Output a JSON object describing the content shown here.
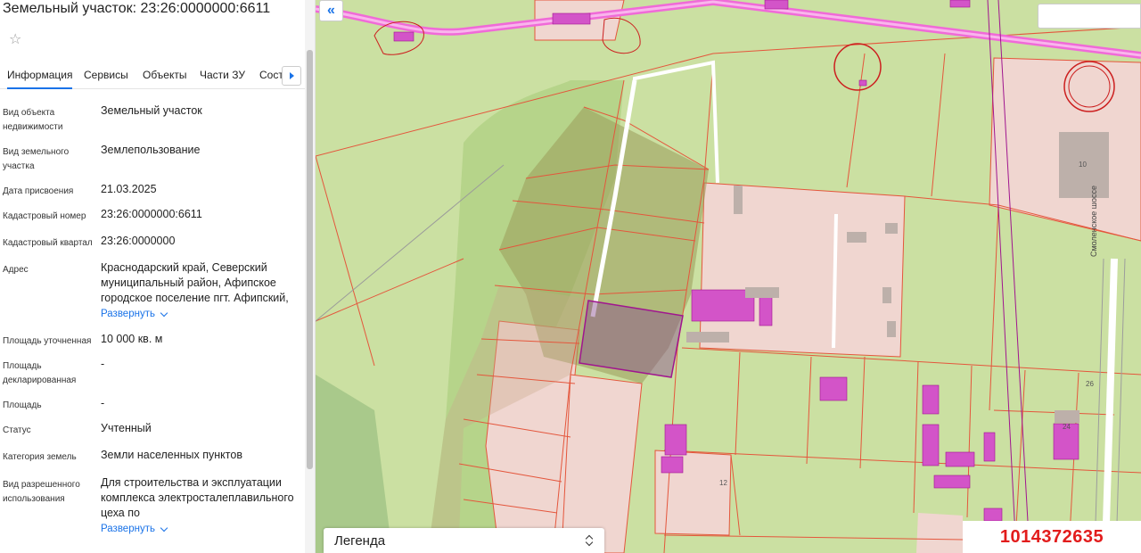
{
  "panel": {
    "title": "Земельный участок: 23:26:0000000:6611",
    "tabs": [
      {
        "label": "Информация"
      },
      {
        "label": "Сервисы"
      },
      {
        "label": "Объекты"
      },
      {
        "label": "Части ЗУ"
      },
      {
        "label": "Состав"
      }
    ],
    "more_label": "Развернуть",
    "rows": [
      {
        "label": "Вид объекта недвижимости",
        "value": "Земельный участок"
      },
      {
        "label": "Вид земельного участка",
        "value": "Землепользование"
      },
      {
        "label": "Дата присвоения",
        "value": "21.03.2025"
      },
      {
        "label": "Кадастровый номер",
        "value": "23:26:0000000:6611"
      },
      {
        "label": "Кадастровый квартал",
        "value": "23:26:0000000"
      },
      {
        "label": "Адрес",
        "value": "Краснодарский край, Северский муниципальный район, Афипское городское поселение пгт. Афипский,"
      },
      {
        "label": "Площадь уточненная",
        "value": "10 000 кв. м"
      },
      {
        "label": "Площадь декларированная",
        "value": "-"
      },
      {
        "label": "Площадь",
        "value": "-"
      },
      {
        "label": "Статус",
        "value": "Учтенный"
      },
      {
        "label": "Категория земель",
        "value": "Земли населенных пунктов"
      },
      {
        "label": "Вид разрешенного использования",
        "value": "Для строительства и эксплуатации комплекса электросталеплавильного цеха по"
      }
    ]
  },
  "map": {
    "collapse_glyph": "«",
    "legend_label": "Легенда",
    "road_label": "Смоленское шоссе",
    "listing_id": "1014372635",
    "parcel_numbers": [
      "10",
      "26",
      "24",
      "12"
    ],
    "colors": {
      "base": "#cbe0a2",
      "forest": "#b6d48a",
      "boundary": "#e4563c",
      "selected": "#a0158f",
      "building": "#d354c8",
      "road": "#f06ad8"
    }
  }
}
